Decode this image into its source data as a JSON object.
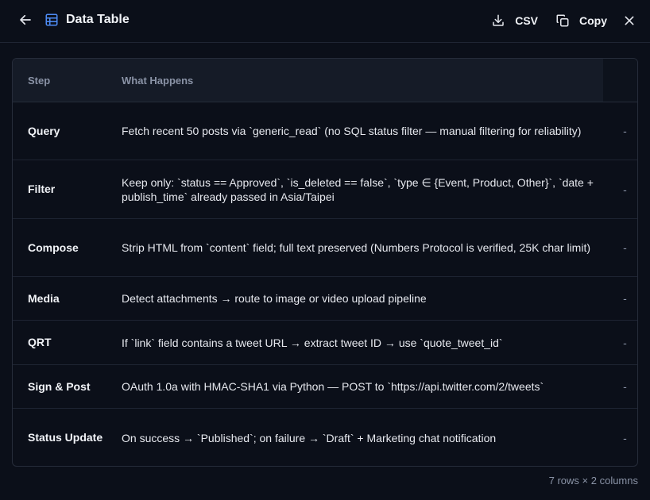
{
  "header": {
    "title": "Data Table",
    "csv_label": "CSV",
    "copy_label": "Copy"
  },
  "table": {
    "columns": [
      "Step",
      "What Happens"
    ],
    "rows": [
      {
        "step": "Query",
        "what": "Fetch recent 50 posts via `generic_read` (no SQL status filter — manual filtering for reliability)",
        "extra": "-"
      },
      {
        "step": "Filter",
        "what": "Keep only: `status == Approved`, `is_deleted == false`, `type ∈ {Event, Product, Other}`, `date + publish_time` already passed in Asia/Taipei",
        "extra": "-"
      },
      {
        "step": "Compose",
        "what": "Strip HTML from `content` field; full text preserved (Numbers Protocol is verified, 25K char limit)",
        "extra": "-"
      },
      {
        "step": "Media",
        "what": "Detect attachments → route to image or video upload pipeline",
        "extra": "-"
      },
      {
        "step": "QRT",
        "what": "If `link` field contains a tweet URL → extract tweet ID → use `quote_tweet_id`",
        "extra": "-"
      },
      {
        "step": "Sign & Post",
        "what": "OAuth 1.0a with HMAC-SHA1 via Python — POST to `https://api.twitter.com/2/tweets`",
        "extra": "-"
      },
      {
        "step": "Status Update",
        "what": "On success → `Published`; on failure → `Draft` + Marketing chat notification",
        "extra": "-"
      }
    ]
  },
  "footer": {
    "summary": "7 rows × 2 columns"
  }
}
